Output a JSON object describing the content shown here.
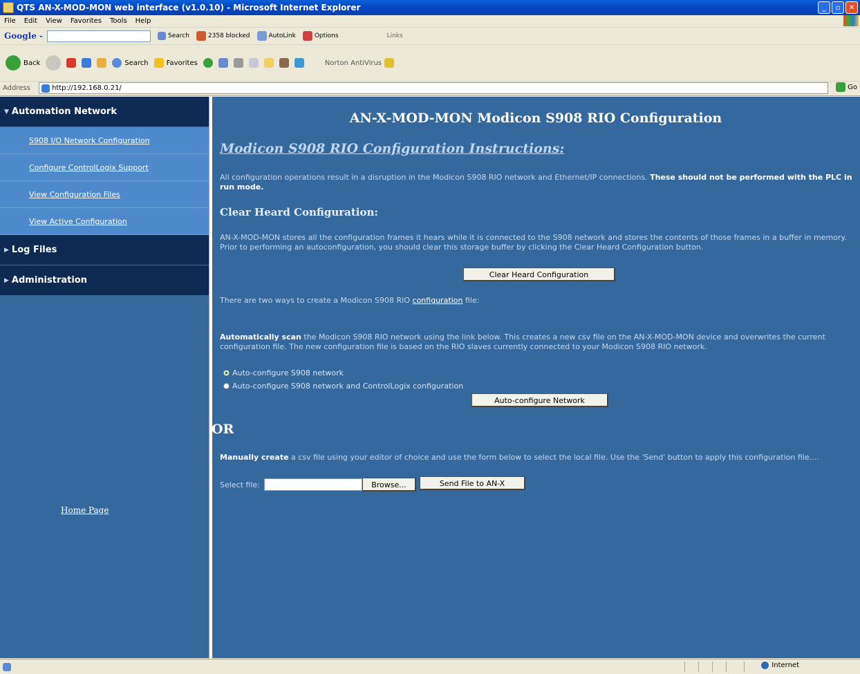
{
  "window": {
    "title": "QTS AN-X-MOD-MON web interface (v1.0.10) - Microsoft Internet Explorer",
    "min": "_",
    "max": "▫",
    "close": "✕"
  },
  "menu": [
    "File",
    "Edit",
    "View",
    "Favorites",
    "Tools",
    "Help"
  ],
  "google_toolbar": {
    "logo": "Google -",
    "search_label": "Search",
    "blocked_label": "2358 blocked",
    "autolink_label": "AutoLink",
    "options_label": "Options",
    "links_label": "Links"
  },
  "std_toolbar": {
    "back": "Back",
    "search": "Search",
    "favorites": "Favorites",
    "norton": "Norton AntiVirus"
  },
  "address": {
    "label": "Address",
    "url": "http://192.168.0.21/",
    "go": "Go"
  },
  "sidebar": {
    "section1": "Automation Network",
    "items": [
      "S908 I/O Network Configuration",
      "Configure ControlLogix Support",
      "View Configuration Files",
      "View Active Configuration"
    ],
    "section2": "Log Files",
    "section3": "Administration",
    "home": "Home Page"
  },
  "main": {
    "title": "AN-X-MOD-MON Modicon S908 RIO Configuration",
    "instructions_heading": "Modicon S908 RIO Configuration Instructions:",
    "intro_text": "All configuration operations result in a disruption in the Modicon S908 RIO network and Ethernet/IP connections.",
    "intro_bold": "These should not be performed with the PLC in run mode.",
    "clear_heading": "Clear Heard Configuration:",
    "clear_text": "AN-X-MOD-MON stores all the configuration frames it hears while it is connected to the S908 network and stores the contents of those frames in a buffer in memory. Prior to performing an autoconfiguration, you should clear this storage buffer by clicking the Clear Heard Configuration button.",
    "clear_button": "Clear Heard Configuration",
    "two_ways_prefix": "There are two ways to create a Modicon S908 RIO",
    "two_ways_link": "configuration",
    "two_ways_suffix": "file:",
    "auto_bold": "Automatically scan",
    "auto_text": "the Modicon S908 RIO network using the link below. This creates a new csv file on the AN-X-MOD-MON device and overwrites the current configuration file. The new configuration file is based on the RIO slaves currently connected to your Modicon S908 RIO network.",
    "radio1": "Auto-configure S908 network",
    "radio2": "Auto-configure S908 network and ControlLogix configuration",
    "auto_button": "Auto-configure Network",
    "or_label": "OR",
    "manual_bold": "Manually create",
    "manual_text": "a csv file using your editor of choice and use the form below to select the local file. Use the 'Send' button to apply this configuration file....",
    "select_label": "Select file:",
    "browse_button": "Browse...",
    "send_button": "Send File to AN-X"
  },
  "status": {
    "zone": "Internet"
  }
}
